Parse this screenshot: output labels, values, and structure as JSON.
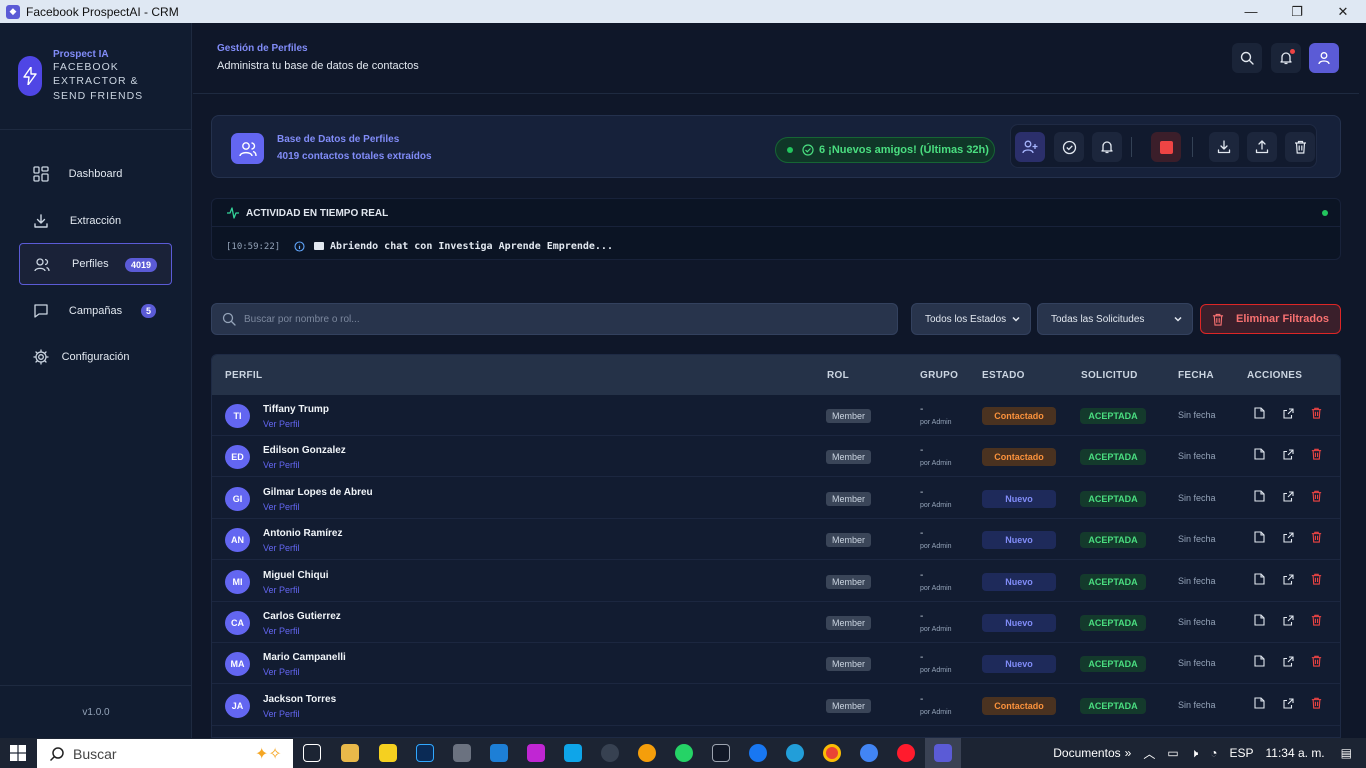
{
  "window": {
    "title": "Facebook ProspectAI - CRM",
    "app_icon": "app-icon"
  },
  "brand": {
    "name": "Prospect IA",
    "subtitle": "FACEBOOK EXTRACTOR & SEND FRIENDS",
    "logo_icon": "bolt-icon"
  },
  "nav": {
    "items": [
      {
        "label": "Dashboard",
        "icon": "dashboard-icon"
      },
      {
        "label": "Extracción",
        "icon": "download-icon"
      },
      {
        "label": "Perfiles",
        "icon": "users-icon",
        "badge": "4019",
        "active": true
      },
      {
        "label": "Campañas",
        "icon": "chat-icon",
        "badge": "5"
      },
      {
        "label": "Configuración",
        "icon": "gear-icon"
      }
    ],
    "version": "v1.0.0"
  },
  "header": {
    "section": "Gestión de Perfiles",
    "description": "Administra tu base de datos de contactos"
  },
  "db_card": {
    "title": "Base de Datos de Perfiles",
    "subtitle": "4019 contactos totales extraídos",
    "new_friends": "6 ¡Nuevos amigos! (Últimas 32h)"
  },
  "activity": {
    "title": "ACTIVIDAD EN TIEMPO REAL",
    "time": "[10:59:22]",
    "message": "Abriendo chat con Investiga Aprende Emprende..."
  },
  "filters": {
    "search_placeholder": "Buscar por nombre o rol...",
    "estado": "Todos los Estados",
    "solicitud": "Todas las Solicitudes",
    "clear": "Eliminar Filtrados"
  },
  "table": {
    "headers": {
      "perfil": "PERFIL",
      "rol": "ROL",
      "grupo": "GRUPO",
      "estado": "ESTADO",
      "solicitud": "SOLICITUD",
      "fecha": "FECHA",
      "acciones": "ACCIONES"
    },
    "link_label": "Ver Perfil",
    "group_sub": "por Admin",
    "rows": [
      {
        "initials": "TI",
        "name": "Tiffany Trump",
        "role": "Member",
        "group": "-",
        "status": "Contactado",
        "request": "ACEPTADA",
        "date": "Sin fecha"
      },
      {
        "initials": "ED",
        "name": "Edilson Gonzalez",
        "role": "Member",
        "group": "-",
        "status": "Contactado",
        "request": "ACEPTADA",
        "date": "Sin fecha"
      },
      {
        "initials": "GI",
        "name": "Gilmar Lopes de Abreu",
        "role": "Member",
        "group": "-",
        "status": "Nuevo",
        "request": "ACEPTADA",
        "date": "Sin fecha"
      },
      {
        "initials": "AN",
        "name": "Antonio Ramírez",
        "role": "Member",
        "group": "-",
        "status": "Nuevo",
        "request": "ACEPTADA",
        "date": "Sin fecha"
      },
      {
        "initials": "MI",
        "name": "Miguel Chiqui",
        "role": "Member",
        "group": "-",
        "status": "Nuevo",
        "request": "ACEPTADA",
        "date": "Sin fecha"
      },
      {
        "initials": "CA",
        "name": "Carlos Gutierrez",
        "role": "Member",
        "group": "-",
        "status": "Nuevo",
        "request": "ACEPTADA",
        "date": "Sin fecha"
      },
      {
        "initials": "MA",
        "name": "Mario Campanelli",
        "role": "Member",
        "group": "-",
        "status": "Nuevo",
        "request": "ACEPTADA",
        "date": "Sin fecha"
      },
      {
        "initials": "JA",
        "name": "Jackson Torres",
        "role": "Member",
        "group": "-",
        "status": "Contactado",
        "request": "ACEPTADA",
        "date": "Sin fecha"
      }
    ]
  },
  "taskbar": {
    "search_placeholder": "Buscar",
    "documents": "Documentos",
    "language": "ESP",
    "time": "11:34 a. m."
  },
  "colors": {
    "accent": "#5b5bd6",
    "success": "#4ade80",
    "warning": "#fb923c",
    "danger": "#ef4444"
  }
}
